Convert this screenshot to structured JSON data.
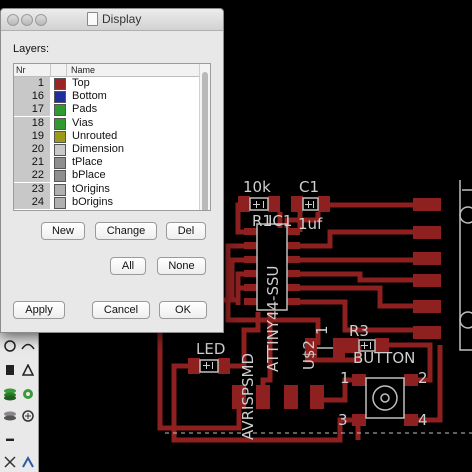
{
  "dialog": {
    "title": "Display",
    "layers_label": "Layers:",
    "columns": {
      "nr": "Nr",
      "name": "Name"
    },
    "layers": [
      {
        "nr": "1",
        "name": "Top",
        "color": "#9b2424"
      },
      {
        "nr": "16",
        "name": "Bottom",
        "color": "#1e2e9c"
      },
      {
        "nr": "17",
        "name": "Pads",
        "color": "#2f9a2f"
      },
      {
        "nr": "18",
        "name": "Vias",
        "color": "#2f9a2f"
      },
      {
        "nr": "19",
        "name": "Unrouted",
        "color": "#9c9a18"
      },
      {
        "nr": "20",
        "name": "Dimension",
        "color": "#c9c9c9"
      },
      {
        "nr": "21",
        "name": "tPlace",
        "color": "#8e8e8e"
      },
      {
        "nr": "22",
        "name": "bPlace",
        "color": "#8e8e8e"
      },
      {
        "nr": "23",
        "name": "tOrigins",
        "color": "#b0b0b0"
      },
      {
        "nr": "24",
        "name": "bOrigins",
        "color": "#b0b0b0"
      }
    ],
    "buttons": {
      "new": "New",
      "change": "Change",
      "del": "Del",
      "all": "All",
      "none": "None",
      "apply": "Apply",
      "cancel": "Cancel",
      "ok": "OK"
    }
  },
  "board": {
    "labels": {
      "r10k": "10k",
      "c1": "C1",
      "r1": "R1",
      "ic1": "IC1",
      "c1_value": "1uf",
      "led": "LED",
      "r3": "R3",
      "button": "BUTTON",
      "attiny": "ATTINY44-SSU",
      "avrispsmd": "AVRISPSMD",
      "us2": "U$2",
      "one": "1",
      "pin1": "1",
      "pin2": "2",
      "pin3": "3",
      "pin4": "4"
    },
    "colors": {
      "trace": "#8e2020",
      "silk": "#cfcfcf",
      "dimension": "#bfbfbf",
      "background": "#000000"
    }
  },
  "palette": {
    "tools": [
      "circle-tool-icon",
      "arc-tool-icon",
      "rect-tool-icon",
      "polygon-tool-icon",
      "layer-stack-icon",
      "via-icon",
      "signal-icon",
      "text-tool-icon",
      "hole-icon",
      "route-icon"
    ]
  }
}
